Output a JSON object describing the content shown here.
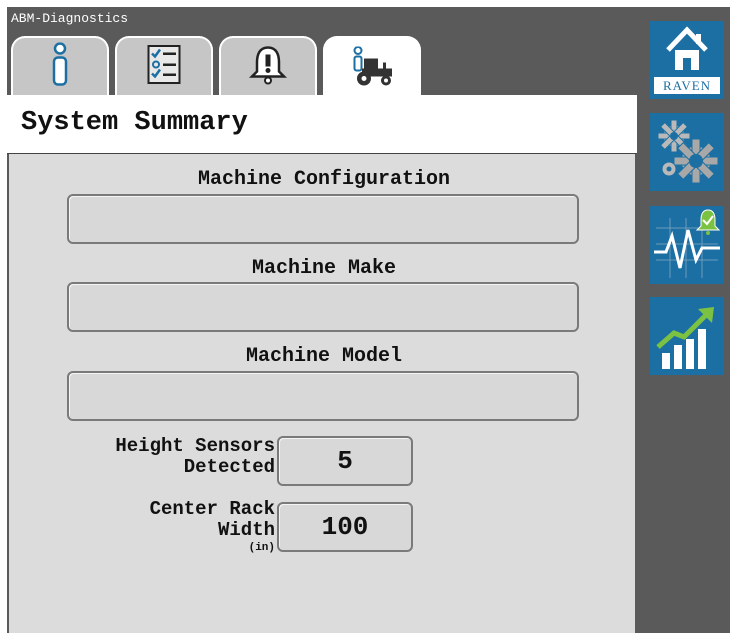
{
  "app": {
    "title": "ABM-Diagnostics"
  },
  "tabs": [
    {
      "icon": "info-icon",
      "active": false
    },
    {
      "icon": "checklist-icon",
      "active": false
    },
    {
      "icon": "alarm-bell-icon",
      "active": false
    },
    {
      "icon": "machine-info-icon",
      "active": true
    }
  ],
  "page": {
    "title": "System Summary"
  },
  "fields": {
    "machine_configuration": {
      "label": "Machine Configuration",
      "value": ""
    },
    "machine_make": {
      "label": "Machine Make",
      "value": ""
    },
    "machine_model": {
      "label": "Machine Model",
      "value": ""
    }
  },
  "height_sensors": {
    "label_line1": "Height Sensors",
    "label_line2": "Detected",
    "value": "5"
  },
  "center_rack": {
    "label_line1": "Center Rack",
    "label_line2": "Width",
    "unit": "(in)",
    "value": "100"
  },
  "sidebar": {
    "home": {
      "icon": "home-icon",
      "brand": "RAVEN"
    },
    "settings": {
      "icon": "gears-icon"
    },
    "diagnostics": {
      "icon": "waveform-alarm-icon"
    },
    "performance": {
      "icon": "growth-chart-icon"
    }
  },
  "colors": {
    "accent": "#1b6fa3",
    "frame": "#5a5a5a",
    "panel": "#dcdcdc",
    "alarm_green": "#7cc242"
  }
}
